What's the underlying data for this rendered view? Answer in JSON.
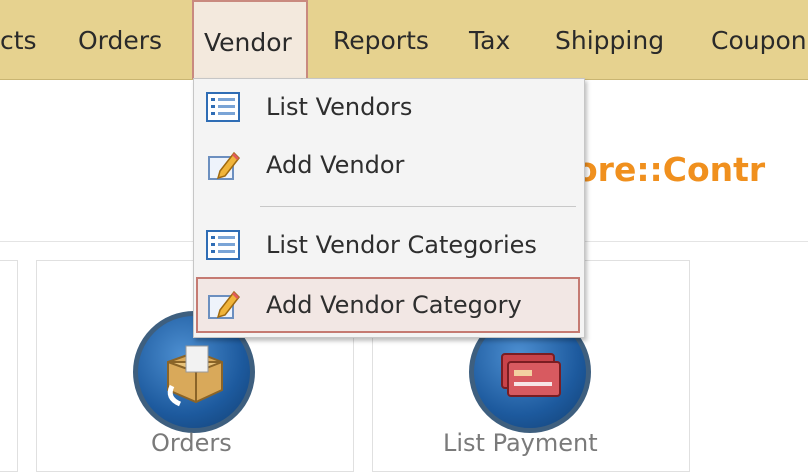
{
  "menubar": {
    "items": [
      {
        "label": "cts"
      },
      {
        "label": "Orders"
      },
      {
        "label": "Vendor"
      },
      {
        "label": "Reports"
      },
      {
        "label": "Tax"
      },
      {
        "label": "Shipping"
      },
      {
        "label": "Coupon"
      }
    ]
  },
  "dropdown": {
    "items": [
      {
        "label": "List Vendors",
        "icon": "list-icon"
      },
      {
        "label": "Add Vendor",
        "icon": "edit-icon"
      },
      {
        "label": "List Vendor Categories",
        "icon": "list-icon"
      },
      {
        "label": "Add Vendor Category",
        "icon": "edit-icon"
      }
    ]
  },
  "page": {
    "title": "ore::Contr"
  },
  "tiles": [
    {
      "label": "Orders",
      "icon": "package-icon"
    },
    {
      "label": "List Payment",
      "icon": "credit-card-icon"
    }
  ],
  "colors": {
    "menubar_bg": "#e6d28f",
    "title": "#f0901e",
    "highlight_border": "#c57a72"
  }
}
